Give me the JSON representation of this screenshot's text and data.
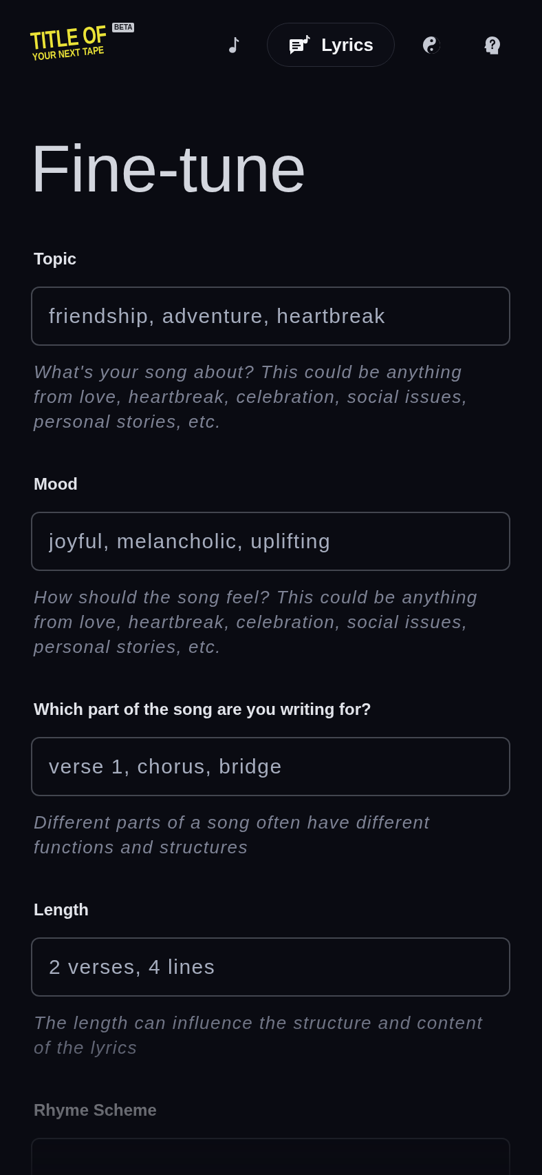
{
  "header": {
    "logo": {
      "title": "TITLE OF",
      "subtitle": "YOUR NEXT TAPE",
      "badge": "BETA"
    },
    "nav": [
      {
        "selected": false
      },
      {
        "label": "Lyrics",
        "selected": true
      },
      {
        "selected": false
      },
      {
        "selected": false
      }
    ]
  },
  "title": "Fine-tune",
  "fields": [
    {
      "label": "Topic",
      "placeholder": "friendship, adventure, heartbreak",
      "help": "What's your song about? This could be anything from love, heartbreak, celebration, social issues, personal stories, etc."
    },
    {
      "label": "Mood",
      "placeholder": "joyful, melancholic, uplifting",
      "help": "How should the song feel? This could be anything from love, heartbreak, celebration, social issues, personal stories, etc."
    },
    {
      "label": "Which part of the song are you writing for?",
      "placeholder": "verse 1, chorus, bridge",
      "help": "Different parts of a song often have different functions and structures"
    },
    {
      "label": "Length",
      "placeholder": "2 verses, 4 lines",
      "help": "The length can influence the structure and content of the lyrics"
    },
    {
      "label": "Rhyme Scheme"
    }
  ]
}
